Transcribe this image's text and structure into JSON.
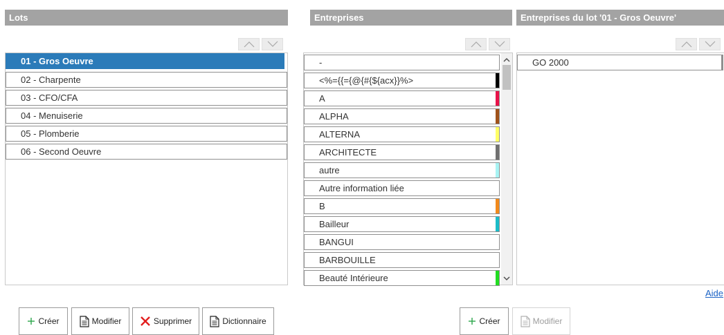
{
  "lots": {
    "title": "Lots",
    "items": [
      {
        "label": "01 - Gros Oeuvre",
        "selected": true
      },
      {
        "label": "02 - Charpente"
      },
      {
        "label": "03 - CFO/CFA"
      },
      {
        "label": "04 - Menuiserie"
      },
      {
        "label": "05 - Plomberie"
      },
      {
        "label": "06 - Second Oeuvre"
      }
    ],
    "buttons": {
      "create": "Créer",
      "modify": "Modifier",
      "delete": "Supprimer",
      "dictionary": "Dictionnaire"
    }
  },
  "entreprises": {
    "title": "Entreprises",
    "items": [
      {
        "label": "-",
        "color": ""
      },
      {
        "label": "<%={{={@{#{${acx}}%>",
        "color": "#000000"
      },
      {
        "label": "A",
        "color": "#e8134a"
      },
      {
        "label": "ALPHA",
        "color": "#a0521a"
      },
      {
        "label": "ALTERNA",
        "color": "#ffff66"
      },
      {
        "label": "ARCHITECTE",
        "color": "#707070"
      },
      {
        "label": "autre",
        "color": "#a8f4f4"
      },
      {
        "label": "Autre information liée",
        "color": ""
      },
      {
        "label": "B",
        "color": "#f28a1c"
      },
      {
        "label": "Bailleur",
        "color": "#1bbcc8"
      },
      {
        "label": "BANGUI",
        "color": ""
      },
      {
        "label": "BARBOUILLE",
        "color": ""
      },
      {
        "label": "Beauté Intérieure",
        "color": "#22dd22"
      }
    ],
    "buttons": {
      "create": "Créer",
      "modify": "Modifier"
    }
  },
  "lot_entreprises": {
    "title": "Entreprises du lot '01 - Gros Oeuvre'",
    "items": [
      {
        "label": "GO 2000"
      }
    ]
  },
  "help_link": "Aide",
  "colors": {
    "header_bg": "#a3a3a3",
    "selected_bg": "#2b7bb9",
    "plus_green": "#2aa64a",
    "delete_red": "#e21e1e",
    "link_blue": "#1a62c5"
  },
  "icons": {
    "move_up": "chevron-up-icon",
    "move_down": "chevron-down-icon",
    "create": "plus-icon",
    "modify": "document-icon",
    "delete": "cross-icon",
    "dictionary": "document-icon"
  }
}
